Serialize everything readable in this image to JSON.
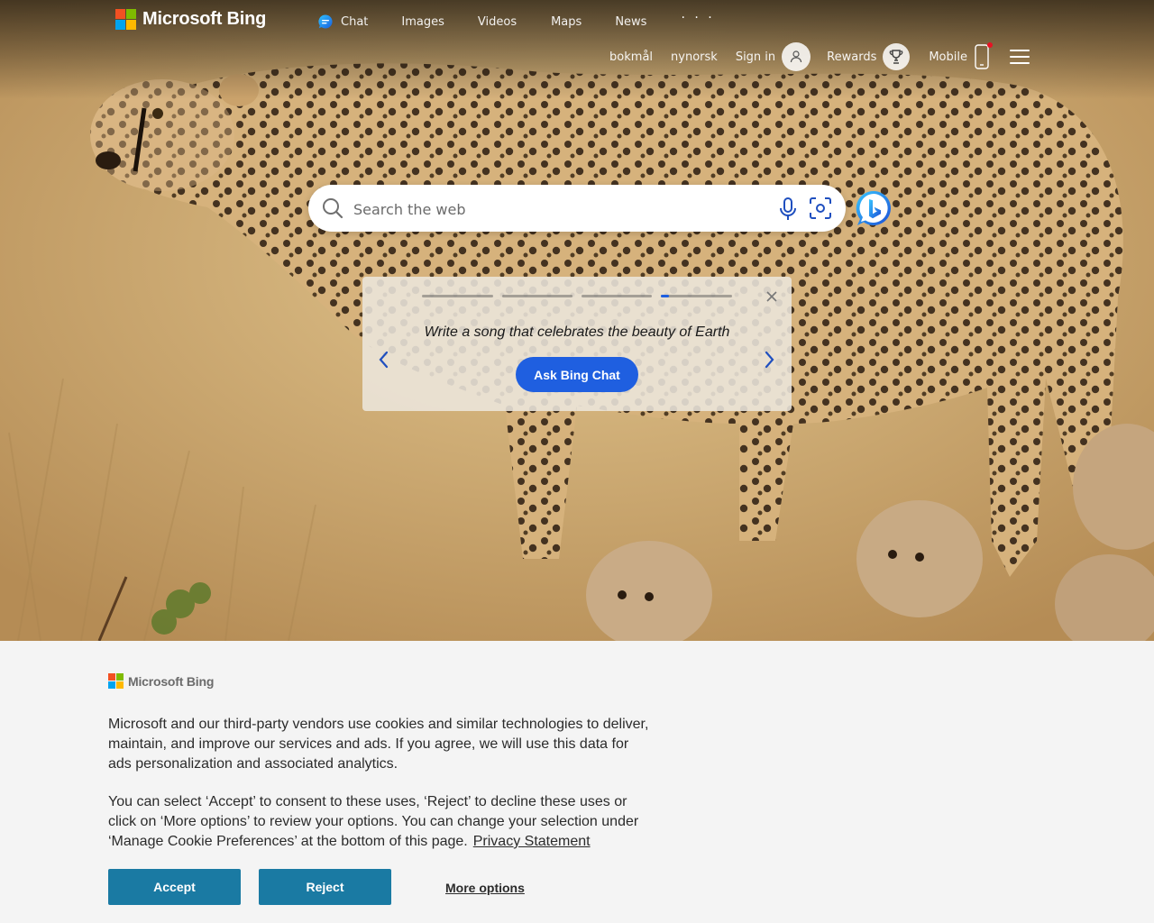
{
  "brand": {
    "name": "Microsoft Bing",
    "logo_colors": [
      "#f25022",
      "#7fba00",
      "#00a4ef",
      "#ffb900"
    ]
  },
  "topnav": {
    "items": [
      {
        "label": "Chat",
        "icon": "bing-chat-icon"
      },
      {
        "label": "Images"
      },
      {
        "label": "Videos"
      },
      {
        "label": "Maps"
      },
      {
        "label": "News"
      }
    ],
    "more_label": "· · ·"
  },
  "header_right": {
    "lang1": "bokmål",
    "lang2": "nynorsk",
    "sign_in": "Sign in",
    "rewards": "Rewards",
    "mobile": "Mobile"
  },
  "search": {
    "placeholder": "Search the web",
    "value": ""
  },
  "suggestion_card": {
    "prompt": "Write a song that celebrates the beauty of Earth",
    "button": "Ask Bing Chat",
    "step_count": 4,
    "active_step": 4,
    "active_progress": 0.12,
    "accent": "#1f5fe0"
  },
  "cookie": {
    "brand": "Microsoft Bing",
    "paragraph1": "Microsoft and our third-party vendors use cookies and similar technologies to deliver, maintain, and improve our services and ads. If you agree, we will use this data for ads personalization and associated analytics.",
    "paragraph2": "You can select ‘Accept’ to consent to these uses, ‘Reject’ to decline these uses or click on ‘More options’ to review your options. You can change your selection under ‘Manage Cookie Preferences’ at the bottom of this page.",
    "privacy_link": "Privacy Statement",
    "accept": "Accept",
    "reject": "Reject",
    "more_options": "More options",
    "button_color": "#1a7aa3"
  }
}
